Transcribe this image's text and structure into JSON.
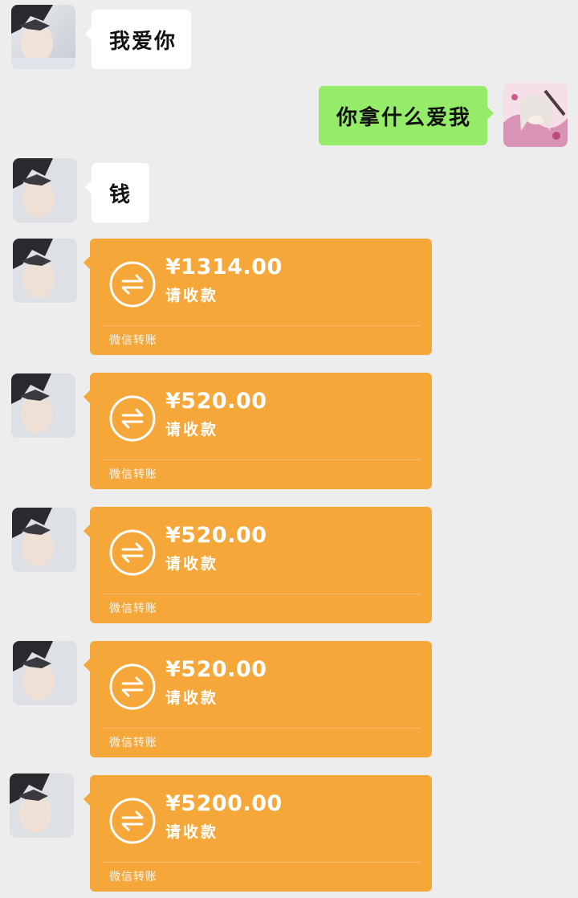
{
  "messages": [
    {
      "side": "left",
      "text": "我爱你"
    },
    {
      "side": "right",
      "text": "你拿什么爱我"
    },
    {
      "side": "left",
      "text": "钱"
    }
  ],
  "transfers": [
    {
      "amount": "¥1314.00",
      "status": "请收款",
      "footer": "微信转账"
    },
    {
      "amount": "¥520.00",
      "status": "请收款",
      "footer": "微信转账"
    },
    {
      "amount": "¥520.00",
      "status": "请收款",
      "footer": "微信转账"
    },
    {
      "amount": "¥520.00",
      "status": "请收款",
      "footer": "微信转账"
    },
    {
      "amount": "¥5200.00",
      "status": "请收款",
      "footer": "微信转账"
    }
  ],
  "colors": {
    "background": "#ededed",
    "incoming_bubble": "#ffffff",
    "outgoing_bubble": "#95ec69",
    "transfer_card": "#f5a73a"
  },
  "icons": {
    "transfer": "transfer-arrows-icon"
  }
}
